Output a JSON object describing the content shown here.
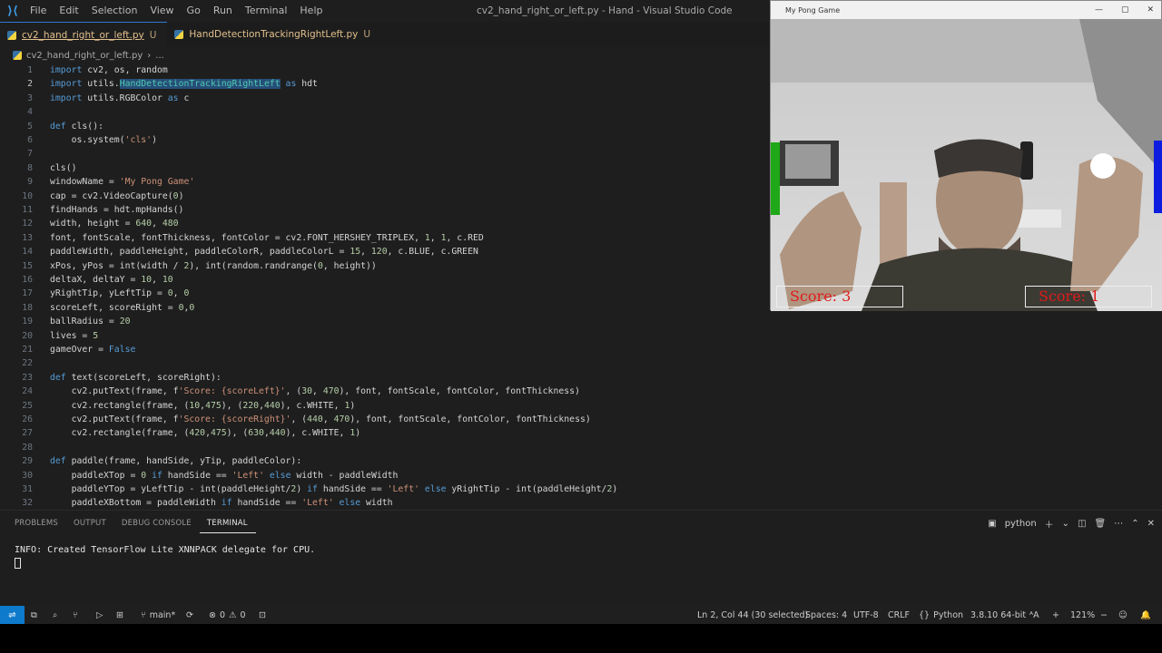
{
  "titlebar": {
    "menus": [
      "File",
      "Edit",
      "Selection",
      "View",
      "Go",
      "Run",
      "Terminal",
      "Help"
    ],
    "title": "cv2_hand_right_or_left.py - Hand - Visual Studio Code"
  },
  "tabs": [
    {
      "label": "cv2_hand_right_or_left.py",
      "status": "U"
    },
    {
      "label": "HandDetectionTrackingRightLeft.py",
      "status": "U"
    }
  ],
  "breadcrumb": {
    "file": "cv2_hand_right_or_left.py",
    "rest": "..."
  },
  "editor": {
    "current_line": 2,
    "lines": [
      "import cv2, os, random",
      "import utils.HandDetectionTrackingRightLeft as hdt",
      "import utils.RGBColor as c",
      "",
      "def cls():",
      "    os.system('cls')",
      "",
      "cls()",
      "windowName = 'My Pong Game'",
      "cap = cv2.VideoCapture(0)",
      "findHands = hdt.mpHands()",
      "width, height = 640, 480",
      "font, fontScale, fontThickness, fontColor = cv2.FONT_HERSHEY_TRIPLEX, 1, 1, c.RED",
      "paddleWidth, paddleHeight, paddleColorR, paddleColorL = 15, 120, c.BLUE, c.GREEN",
      "xPos, yPos = int(width / 2), int(random.randrange(0, height))",
      "deltaX, deltaY = 10, 10",
      "yRightTip, yLeftTip = 0, 0",
      "scoreLeft, scoreRight = 0,0",
      "ballRadius = 20",
      "lives = 5",
      "gameOver = False",
      "",
      "def text(scoreLeft, scoreRight):",
      "    cv2.putText(frame, f'Score: {scoreLeft}', (30, 470), font, fontScale, fontColor, fontThickness)",
      "    cv2.rectangle(frame, (10,475), (220,440), c.WHITE, 1)",
      "    cv2.putText(frame, f'Score: {scoreRight}', (440, 470), font, fontScale, fontColor, fontThickness)",
      "    cv2.rectangle(frame, (420,475), (630,440), c.WHITE, 1)",
      "",
      "def paddle(frame, handSide, yTip, paddleColor):",
      "    paddleXTop = 0 if handSide == 'Left' else width - paddleWidth",
      "    paddleYTop = yLeftTip - int(paddleHeight/2) if handSide == 'Left' else yRightTip - int(paddleHeight/2)",
      "    paddleXBottom = paddleWidth if handSide == 'Left' else width"
    ]
  },
  "panel": {
    "tabs": [
      "PROBLEMS",
      "OUTPUT",
      "DEBUG CONSOLE",
      "TERMINAL"
    ],
    "active_tab": "TERMINAL",
    "shell": "python",
    "terminal_output": "INFO: Created TensorFlow Lite XNNPACK delegate for CPU."
  },
  "statusbar": {
    "branch": "main*",
    "errors": "0",
    "warnings": "0",
    "cursor": "Ln 2, Col 44 (30 selected)",
    "spaces": "Spaces: 4",
    "encoding": "UTF-8",
    "eol": "CRLF",
    "language": "Python",
    "interpreter": "3.8.10 64-bit",
    "zoom": "121%"
  },
  "pong_window": {
    "title": "My Pong Game",
    "score_left": "Score: 3",
    "score_right": "Score: 1",
    "colors": {
      "left_paddle": "#1fa817",
      "right_paddle": "#0d1de0",
      "score_text": "#e11b1b"
    }
  },
  "colors": {
    "accent": "#0e7acc",
    "editor_bg": "#1e1e1e"
  }
}
